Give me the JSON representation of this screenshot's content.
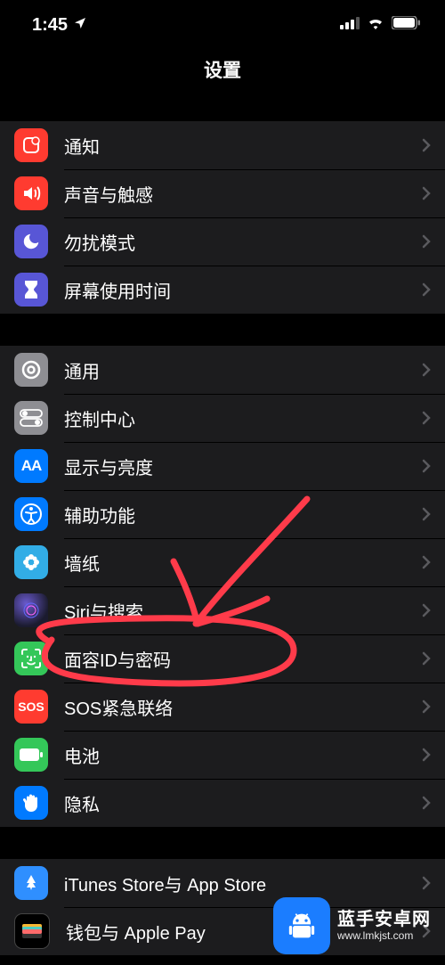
{
  "status": {
    "time": "1:45"
  },
  "header": {
    "title": "设置"
  },
  "groups": [
    {
      "rows": [
        {
          "key": "notifications",
          "label": "通知",
          "icon": "notifications-icon"
        },
        {
          "key": "sounds",
          "label": "声音与触感",
          "icon": "speaker-icon"
        },
        {
          "key": "dnd",
          "label": "勿扰模式",
          "icon": "moon-icon"
        },
        {
          "key": "screentime",
          "label": "屏幕使用时间",
          "icon": "hourglass-icon"
        }
      ]
    },
    {
      "rows": [
        {
          "key": "general",
          "label": "通用",
          "icon": "gear-icon"
        },
        {
          "key": "control",
          "label": "控制中心",
          "icon": "switches-icon"
        },
        {
          "key": "display",
          "label": "显示与亮度",
          "icon": "text-size-icon"
        },
        {
          "key": "accessibility",
          "label": "辅助功能",
          "icon": "accessibility-icon"
        },
        {
          "key": "wallpaper",
          "label": "墙纸",
          "icon": "flower-icon"
        },
        {
          "key": "siri",
          "label": "Siri与搜索",
          "icon": "siri-icon"
        },
        {
          "key": "faceid",
          "label": "面容ID与密码",
          "icon": "faceid-icon"
        },
        {
          "key": "sos",
          "label": "SOS紧急联络",
          "icon": "sos-icon"
        },
        {
          "key": "battery",
          "label": "电池",
          "icon": "battery-icon"
        },
        {
          "key": "privacy",
          "label": "隐私",
          "icon": "hand-icon"
        }
      ]
    },
    {
      "rows": [
        {
          "key": "itunes",
          "label": "iTunes Store与 App Store",
          "icon": "appstore-icon"
        },
        {
          "key": "wallet",
          "label": "钱包与 Apple Pay",
          "icon": "wallet-icon"
        }
      ]
    }
  ],
  "watermark": {
    "name": "蓝手安卓网",
    "url": "www.lmkjst.com"
  },
  "annotation": {
    "circled_item_key": "faceid",
    "stroke": "#ff3b4a"
  }
}
